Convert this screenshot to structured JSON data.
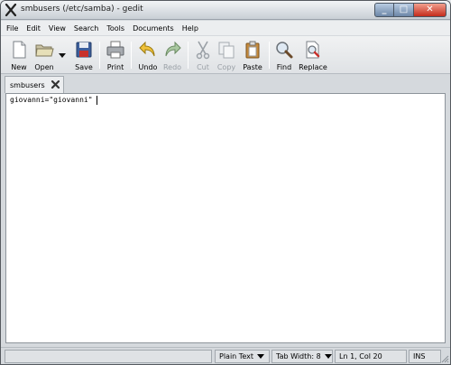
{
  "window": {
    "title": "smbusers (/etc/samba) - gedit",
    "controls": {
      "minimize": "_",
      "maximize": "□",
      "close": "✕"
    }
  },
  "menu": [
    "File",
    "Edit",
    "View",
    "Search",
    "Tools",
    "Documents",
    "Help"
  ],
  "toolbar": {
    "new": "New",
    "open": "Open",
    "save": "Save",
    "print": "Print",
    "undo": "Undo",
    "redo": "Redo",
    "cut": "Cut",
    "copy": "Copy",
    "paste": "Paste",
    "find": "Find",
    "replace": "Replace"
  },
  "tab": {
    "label": "smbusers"
  },
  "editor": {
    "content": "giovanni=\"giovanni\""
  },
  "status": {
    "language": "Plain Text",
    "tab_width": "Tab Width:  8",
    "position": "Ln 1, Col 20",
    "mode": "INS"
  },
  "colors": {
    "titlebar": "#d7dce1",
    "close_button": "#c42b1c",
    "editor_bg": "#ffffff"
  }
}
